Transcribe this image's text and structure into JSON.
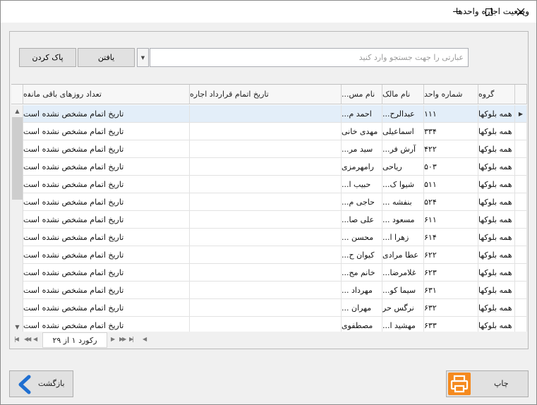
{
  "window": {
    "title": "وضعیت اجاره واحدها"
  },
  "search": {
    "placeholder": "عبارتی را جهت جستجو وارد کنید",
    "value": "",
    "find_label": "یافتن",
    "clear_label": "پاک کردن"
  },
  "grid": {
    "columns": [
      "گروه",
      "شماره واحد",
      "نام مالک",
      "نام مس...",
      "تاریخ اتمام قرارداد اجاره",
      "تعداد روزهای باقی مانده"
    ],
    "rows": [
      [
        "همه بلوکها",
        "۱۱۱",
        "عبدالرح...",
        "احمد م...",
        "",
        "تاریخ اتمام مشخص نشده است"
      ],
      [
        "همه بلوکها",
        "۳۳۴",
        "اسماعیلی",
        "مهدی خانی",
        "",
        "تاریخ اتمام مشخص نشده است"
      ],
      [
        "همه بلوکها",
        "۴۲۲",
        "آرش فر...",
        "سید مر...",
        "",
        "تاریخ اتمام مشخص نشده است"
      ],
      [
        "همه بلوکها",
        "۵۰۳",
        "ریاحی",
        "رامهرمزی",
        "",
        "تاریخ اتمام مشخص نشده است"
      ],
      [
        "همه بلوکها",
        "۵۱۱",
        "شیوا ک...",
        "حبیب ا...",
        "",
        "تاریخ اتمام مشخص نشده است"
      ],
      [
        "همه بلوکها",
        "۵۲۴",
        "بنفشه ...",
        "حاجی م...",
        "",
        "تاریخ اتمام مشخص نشده است"
      ],
      [
        "همه بلوکها",
        "۶۱۱",
        "مسعود ...",
        "علی صا...",
        "",
        "تاریخ اتمام مشخص نشده است"
      ],
      [
        "همه بلوکها",
        "۶۱۴",
        "زهرا ا...",
        "محسن ...",
        "",
        "تاریخ اتمام مشخص نشده است"
      ],
      [
        "همه بلوکها",
        "۶۲۲",
        "عطا مرادی",
        "کیوان ح...",
        "",
        "تاریخ اتمام مشخص نشده است"
      ],
      [
        "همه بلوکها",
        "۶۲۳",
        "غلامرضا...",
        "خانم مح...",
        "",
        "تاریخ اتمام مشخص نشده است"
      ],
      [
        "همه بلوکها",
        "۶۳۱",
        "سیما کو...",
        "مهرداد ...",
        "",
        "تاریخ اتمام مشخص نشده است"
      ],
      [
        "همه بلوکها",
        "۶۳۲",
        "نرگس حر",
        "مهران ...",
        "",
        "تاریخ اتمام مشخص نشده است"
      ],
      [
        "همه بلوکها",
        "۶۳۳",
        "مهشید ا...",
        "مصطفوی",
        "",
        "تاریخ اتمام مشخص نشده است"
      ]
    ]
  },
  "navigator": {
    "record_text": "رکورد ۱ از ۲۹"
  },
  "footer": {
    "back_label": "بازگشت",
    "print_label": "چاپ"
  },
  "colors": {
    "accent_orange": "#f58a1f",
    "back_arrow_blue": "#1f6fd1",
    "selected_row": "#e3eef9"
  }
}
